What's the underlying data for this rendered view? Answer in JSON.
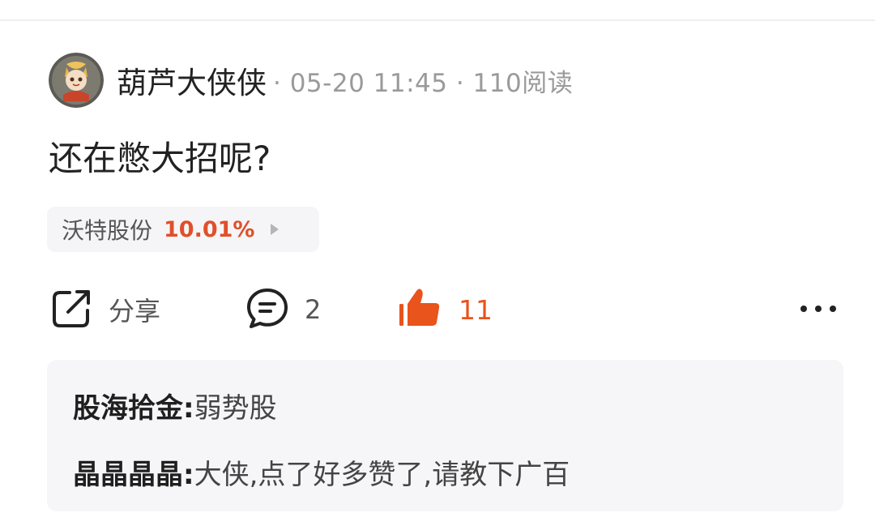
{
  "post": {
    "author": "葫芦大侠侠",
    "meta": "· 05-20 11:45 · 110阅读",
    "text": "还在憋大招呢?"
  },
  "stock": {
    "name": "沃特股份",
    "change": "10.01%",
    "change_color": "#e0502a"
  },
  "actions": {
    "share_label": "分享",
    "comment_count": "2",
    "like_count": "11",
    "like_color": "#e8541c",
    "icons": [
      "share-icon",
      "comment-icon",
      "thumbs-up-icon",
      "more-icon"
    ]
  },
  "comments": [
    {
      "author": "股海拾金",
      "separator": ":",
      "text": "弱势股"
    },
    {
      "author": "晶晶晶晶",
      "separator": ":",
      "text": "大侠,点了好多赞了,请教下广百"
    }
  ]
}
